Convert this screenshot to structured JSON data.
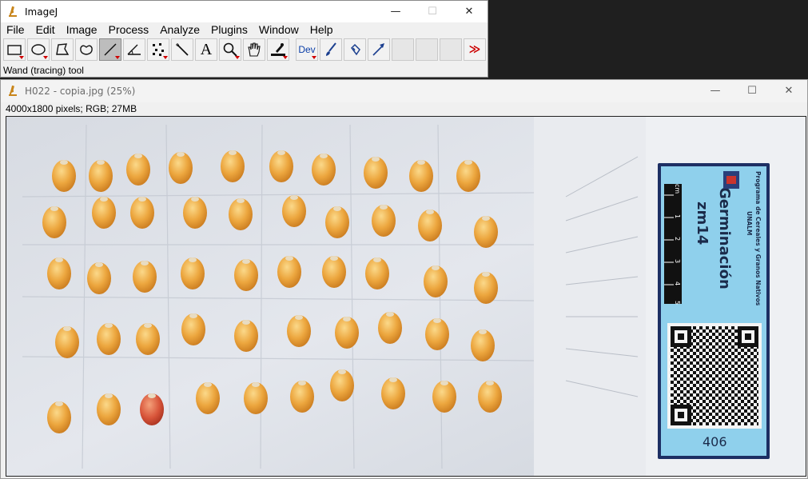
{
  "main_window": {
    "title": "ImageJ",
    "menu": [
      "File",
      "Edit",
      "Image",
      "Process",
      "Analyze",
      "Plugins",
      "Window",
      "Help"
    ],
    "tools": [
      {
        "name": "rectangle-tool",
        "icon": "rectangle-icon"
      },
      {
        "name": "oval-tool",
        "icon": "oval-icon"
      },
      {
        "name": "polygon-tool",
        "icon": "polygon-icon"
      },
      {
        "name": "freehand-tool",
        "icon": "freehand-icon"
      },
      {
        "name": "line-tool",
        "icon": "line-icon"
      },
      {
        "name": "angle-tool",
        "icon": "angle-icon"
      },
      {
        "name": "point-tool",
        "icon": "multipoint-icon"
      },
      {
        "name": "wand-tool",
        "icon": "wand-icon"
      },
      {
        "name": "text-tool",
        "icon": "text-icon",
        "label": "A"
      },
      {
        "name": "magnifying-tool",
        "icon": "magnifier-icon"
      },
      {
        "name": "scrolling-tool",
        "icon": "hand-icon"
      },
      {
        "name": "color-picker-tool",
        "icon": "dropper-icon"
      },
      {
        "name": "dev-menu-tool",
        "icon": "dev-icon",
        "label": "Dev"
      },
      {
        "name": "brush-tool",
        "icon": "brush-icon"
      },
      {
        "name": "flood-fill-tool",
        "icon": "flood-fill-icon"
      },
      {
        "name": "arrow-tool",
        "icon": "arrow-icon"
      },
      {
        "name": "empty-slot-1",
        "icon": ""
      },
      {
        "name": "empty-slot-2",
        "icon": ""
      },
      {
        "name": "empty-slot-3",
        "icon": ""
      },
      {
        "name": "more-tools",
        "icon": "double-chevron-icon",
        "label": "≫"
      }
    ],
    "status": "Wand (tracing) tool",
    "accent_color": "#cc0000",
    "selected_tool": "line-tool"
  },
  "image_window": {
    "title": "H022 - copia.jpg (25%)",
    "info": "4000x1800 pixels; RGB; 27MB",
    "label_card": {
      "line1": "Programa de Cereales y Granos Nativos",
      "line2": "UNALM",
      "heading": "Germinación",
      "code": "zm14",
      "number": "406",
      "ruler_marks": [
        "cm",
        "1",
        "2",
        "3",
        "4",
        "5"
      ]
    }
  }
}
